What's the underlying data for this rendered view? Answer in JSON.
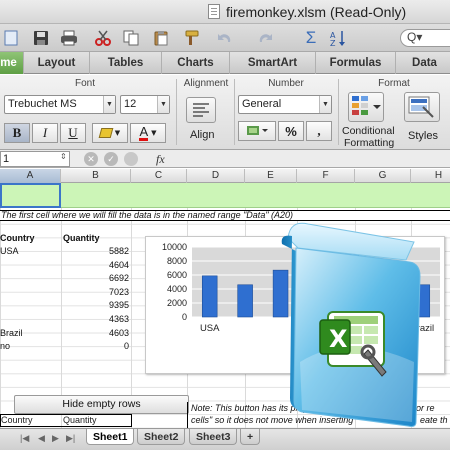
{
  "window": {
    "title": "firemonkey.xlsm  (Read-Only)"
  },
  "toolbar": {
    "icons": [
      "new-icon",
      "open-icon",
      "save-icon",
      "print-icon",
      "cut-icon",
      "copy-icon",
      "paste-icon",
      "format-painter-icon",
      "undo-icon",
      "redo-icon",
      "autosum-icon",
      "sort-icon"
    ],
    "search_label": "Q▾"
  },
  "ribbon_tabs": [
    {
      "label": "me",
      "active": true
    },
    {
      "label": "Layout",
      "active": false
    },
    {
      "label": "Tables",
      "active": false
    },
    {
      "label": "Charts",
      "active": false
    },
    {
      "label": "SmartArt",
      "active": false
    },
    {
      "label": "Formulas",
      "active": false
    },
    {
      "label": "Data",
      "active": false
    }
  ],
  "ribbon": {
    "font_group": "Font",
    "alignment_group": "Alignment",
    "number_group": "Number",
    "format_group": "Format",
    "font_name": "Trebuchet MS",
    "font_size": "12",
    "bold": "B",
    "italic": "I",
    "underline": "U",
    "font_color_letter": "A",
    "align_label": "Align",
    "number_format": "General",
    "percent": "%",
    "comma": ",",
    "conditional_line1": "Conditional",
    "conditional_line2": "Formatting",
    "styles_label": "Styles"
  },
  "formula_bar": {
    "name_box": "1",
    "fx": "fx"
  },
  "columns": [
    "A",
    "B",
    "C",
    "D",
    "E",
    "F",
    "G",
    "H"
  ],
  "sheet": {
    "note1": "The first cell where we will fill the data is in the named range \"Data\" (A20)",
    "header_country": "Country",
    "header_quantity": "Quantity",
    "rows": [
      {
        "country": "USA",
        "quantity": "5882"
      },
      {
        "country": "",
        "quantity": "4604"
      },
      {
        "country": "",
        "quantity": "6692"
      },
      {
        "country": "",
        "quantity": "7023"
      },
      {
        "country": "",
        "quantity": "9395"
      },
      {
        "country": "",
        "quantity": "4363"
      },
      {
        "country": "Brazil",
        "quantity": "4603"
      },
      {
        "country": "no",
        "quantity": "0"
      }
    ],
    "hide_button": "Hide  empty  rows",
    "note2_line1": "Note: This button has its prope",
    "note2_line1b": "or re",
    "note2_line2": "cells\" so it does not move when inserting",
    "note2_line2b": "eate th",
    "bottom_country": "Country",
    "bottom_quantity": "Quantity"
  },
  "sheet_tabs": [
    {
      "label": "Sheet1",
      "active": true
    },
    {
      "label": "Sheet2",
      "active": false
    },
    {
      "label": "Sheet3",
      "active": false
    },
    {
      "label": "+",
      "active": false
    }
  ],
  "chart_data": {
    "type": "bar",
    "categories": [
      "USA",
      "",
      "",
      "",
      "",
      "",
      "Brazil"
    ],
    "values": [
      5882,
      4604,
      6692,
      7023,
      9395,
      4363,
      4603
    ],
    "yticks": [
      "10000",
      "8000",
      "6000",
      "4000",
      "2000",
      "0"
    ],
    "ylim": [
      0,
      10000
    ],
    "grid": true,
    "colors": {
      "bar": "#2f6fd0",
      "plot_bg": "#d9d9d9"
    }
  },
  "product_box": {
    "logo_letter": "X"
  }
}
